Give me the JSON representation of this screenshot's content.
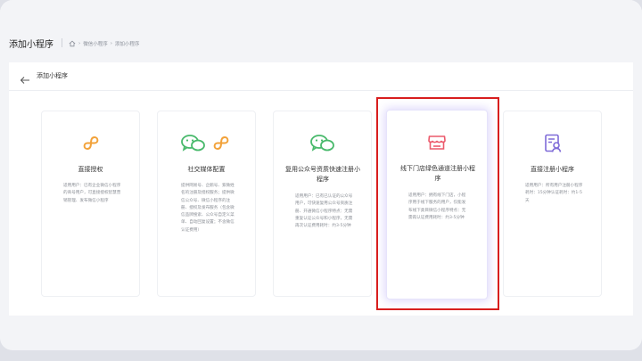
{
  "page": {
    "title": "添加小程序",
    "breadcrumb": [
      "微信小程序",
      "添加小程序"
    ]
  },
  "panel": {
    "title": "添加小程序"
  },
  "cards": [
    {
      "title": "直接授权",
      "icons": [
        "mini-program-icon"
      ],
      "desc": "适用用户：已有企业微信小程序的商号用户，可直接授权智慧营销管理、发布微信小程序"
    },
    {
      "title": "社交媒体配置",
      "icons": [
        "wechat-icon",
        "mini-program-icon"
      ],
      "desc": "提供网易号、企鹅号、紫微姓名的注册及授权服务；提供微信公众号、微信小程序的注册、授权及发布服务（包含微信品牌搜索、公众号自定义菜单、自动回复设置；不含微信认证费用）"
    },
    {
      "title": "复用公众号资质快速注册小程序",
      "icons": [
        "wechat-icon"
      ],
      "desc": "适用用户：已有已认证的公众号用户，可快速复用公众号资质注册、开通微信小程序特点：无需重复认证公众号和小程序，无需再次认证费用耗时：约3-5分钟"
    },
    {
      "title": "线下门店绿色通道注册小程序",
      "icons": [
        "store-icon"
      ],
      "desc": "适用用户：拥有线下门店，小程序用于线下服务的用户，仅能发布线下类目微信小程序特点：无需再认证费用耗时：约3-5分钟"
    },
    {
      "title": "直接注册小程序",
      "icons": [
        "register-icon"
      ],
      "desc": "适用用户：所有用户注册小程序耗时：15分钟认证耗时：约1-5天"
    }
  ],
  "colors": {
    "orange": "#f2a23a",
    "green": "#48b96b",
    "pink": "#ec5a6c",
    "purple": "#7f6bd8",
    "highlight": "#d81e1e"
  }
}
